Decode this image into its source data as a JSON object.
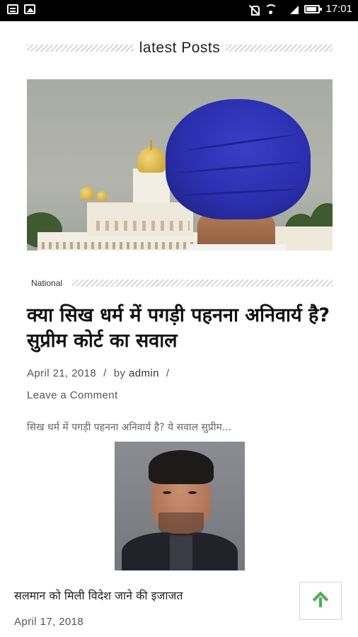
{
  "status_bar": {
    "time": "17:01",
    "left_icons": [
      "message-icon",
      "image-icon"
    ],
    "right_icons": [
      "mute-icon",
      "wifi-icon",
      "signal-icon",
      "battery-icon"
    ]
  },
  "section": {
    "title": "latest Posts"
  },
  "featured_post": {
    "category": "National",
    "title": "क्या सिख धर्म में पगड़ी पहनना अनिवार्य है? सुप्रीम कोर्ट का सवाल",
    "date": "April 21, 2018",
    "author_prefix": "by",
    "author": "admin",
    "separator": "/",
    "comment_link": "Leave a Comment",
    "excerpt": "सिख धर्म में पगड़ी पहनना अनिवार्य है? ये सवाल सुप्रीम..."
  },
  "second_post": {
    "title": "सलमान को मिली विदेश जाने की इजाजत",
    "date": "April 17, 2018"
  },
  "colors": {
    "accent_green": "#4caf50",
    "turban_blue": "#2a2fae"
  }
}
